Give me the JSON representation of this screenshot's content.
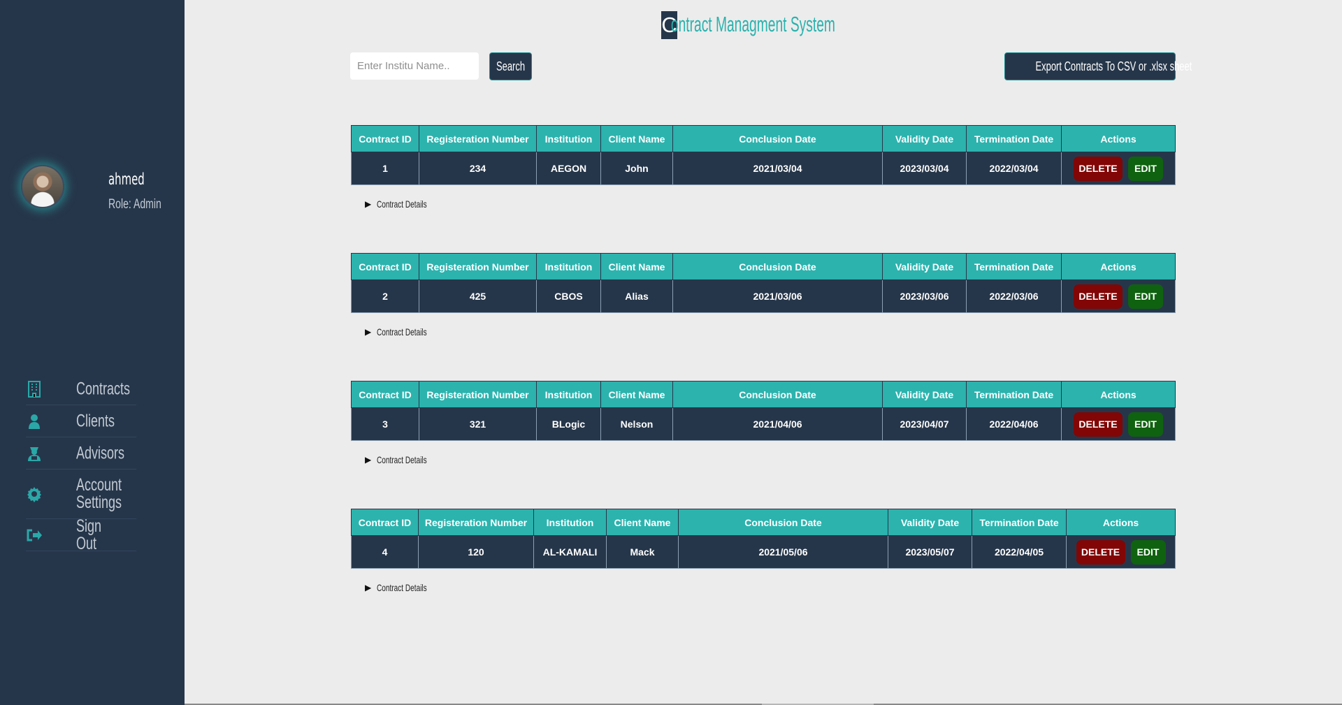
{
  "sidebar": {
    "user": {
      "name": "ahmed",
      "role": "Role: Admin"
    },
    "items": [
      {
        "label": "Contracts",
        "icon": "building-icon"
      },
      {
        "label": "Clients",
        "icon": "user-icon"
      },
      {
        "label": "Advisors",
        "icon": "advisor-icon"
      },
      {
        "label": "Account\nSettings",
        "icon": "gear-icon"
      },
      {
        "label": "Sign Out",
        "icon": "sign-out-icon"
      }
    ]
  },
  "header": {
    "title_first_letter": "C",
    "title_rest": "ontract Managment System"
  },
  "toolbar": {
    "search_placeholder": "Enter Institu Name..",
    "search_label": "Search",
    "export_label": "Export Contracts To CSV or .xlsx sheet"
  },
  "table_headers": [
    "Contract ID",
    "Registeration Number",
    "Institution",
    "Client Name",
    "Conclusion Date",
    "Validity Date",
    "Termination Date",
    "Actions"
  ],
  "contracts": [
    {
      "id": "1",
      "registration": "234",
      "institution": "AEGON",
      "client": "John",
      "conclusion": "2021/03/04",
      "validity": "2023/03/04",
      "termination": "2022/03/04",
      "delete": "DELETE",
      "edit": "EDIT",
      "details": "Contract Details"
    },
    {
      "id": "2",
      "registration": "425",
      "institution": "CBOS",
      "client": "Alias",
      "conclusion": "2021/03/06",
      "validity": "2023/03/06",
      "termination": "2022/03/06",
      "delete": "DELETE",
      "edit": "EDIT",
      "details": "Contract Details"
    },
    {
      "id": "3",
      "registration": "321",
      "institution": "BLogic",
      "client": "Nelson",
      "conclusion": "2021/04/06",
      "validity": "2023/04/07",
      "termination": "2022/04/06",
      "delete": "DELETE",
      "edit": "EDIT",
      "details": "Contract Details"
    },
    {
      "id": "4",
      "registration": "120",
      "institution": "AL-KAMALI",
      "client": "Mack",
      "conclusion": "2021/05/06",
      "validity": "2023/05/07",
      "termination": "2022/04/05",
      "delete": "DELETE",
      "edit": "EDIT",
      "details": "Contract Details"
    }
  ],
  "colors": {
    "sidebar": "#26364a",
    "accent": "#2cb3ae",
    "delete": "#820606",
    "edit": "#0f620f"
  }
}
